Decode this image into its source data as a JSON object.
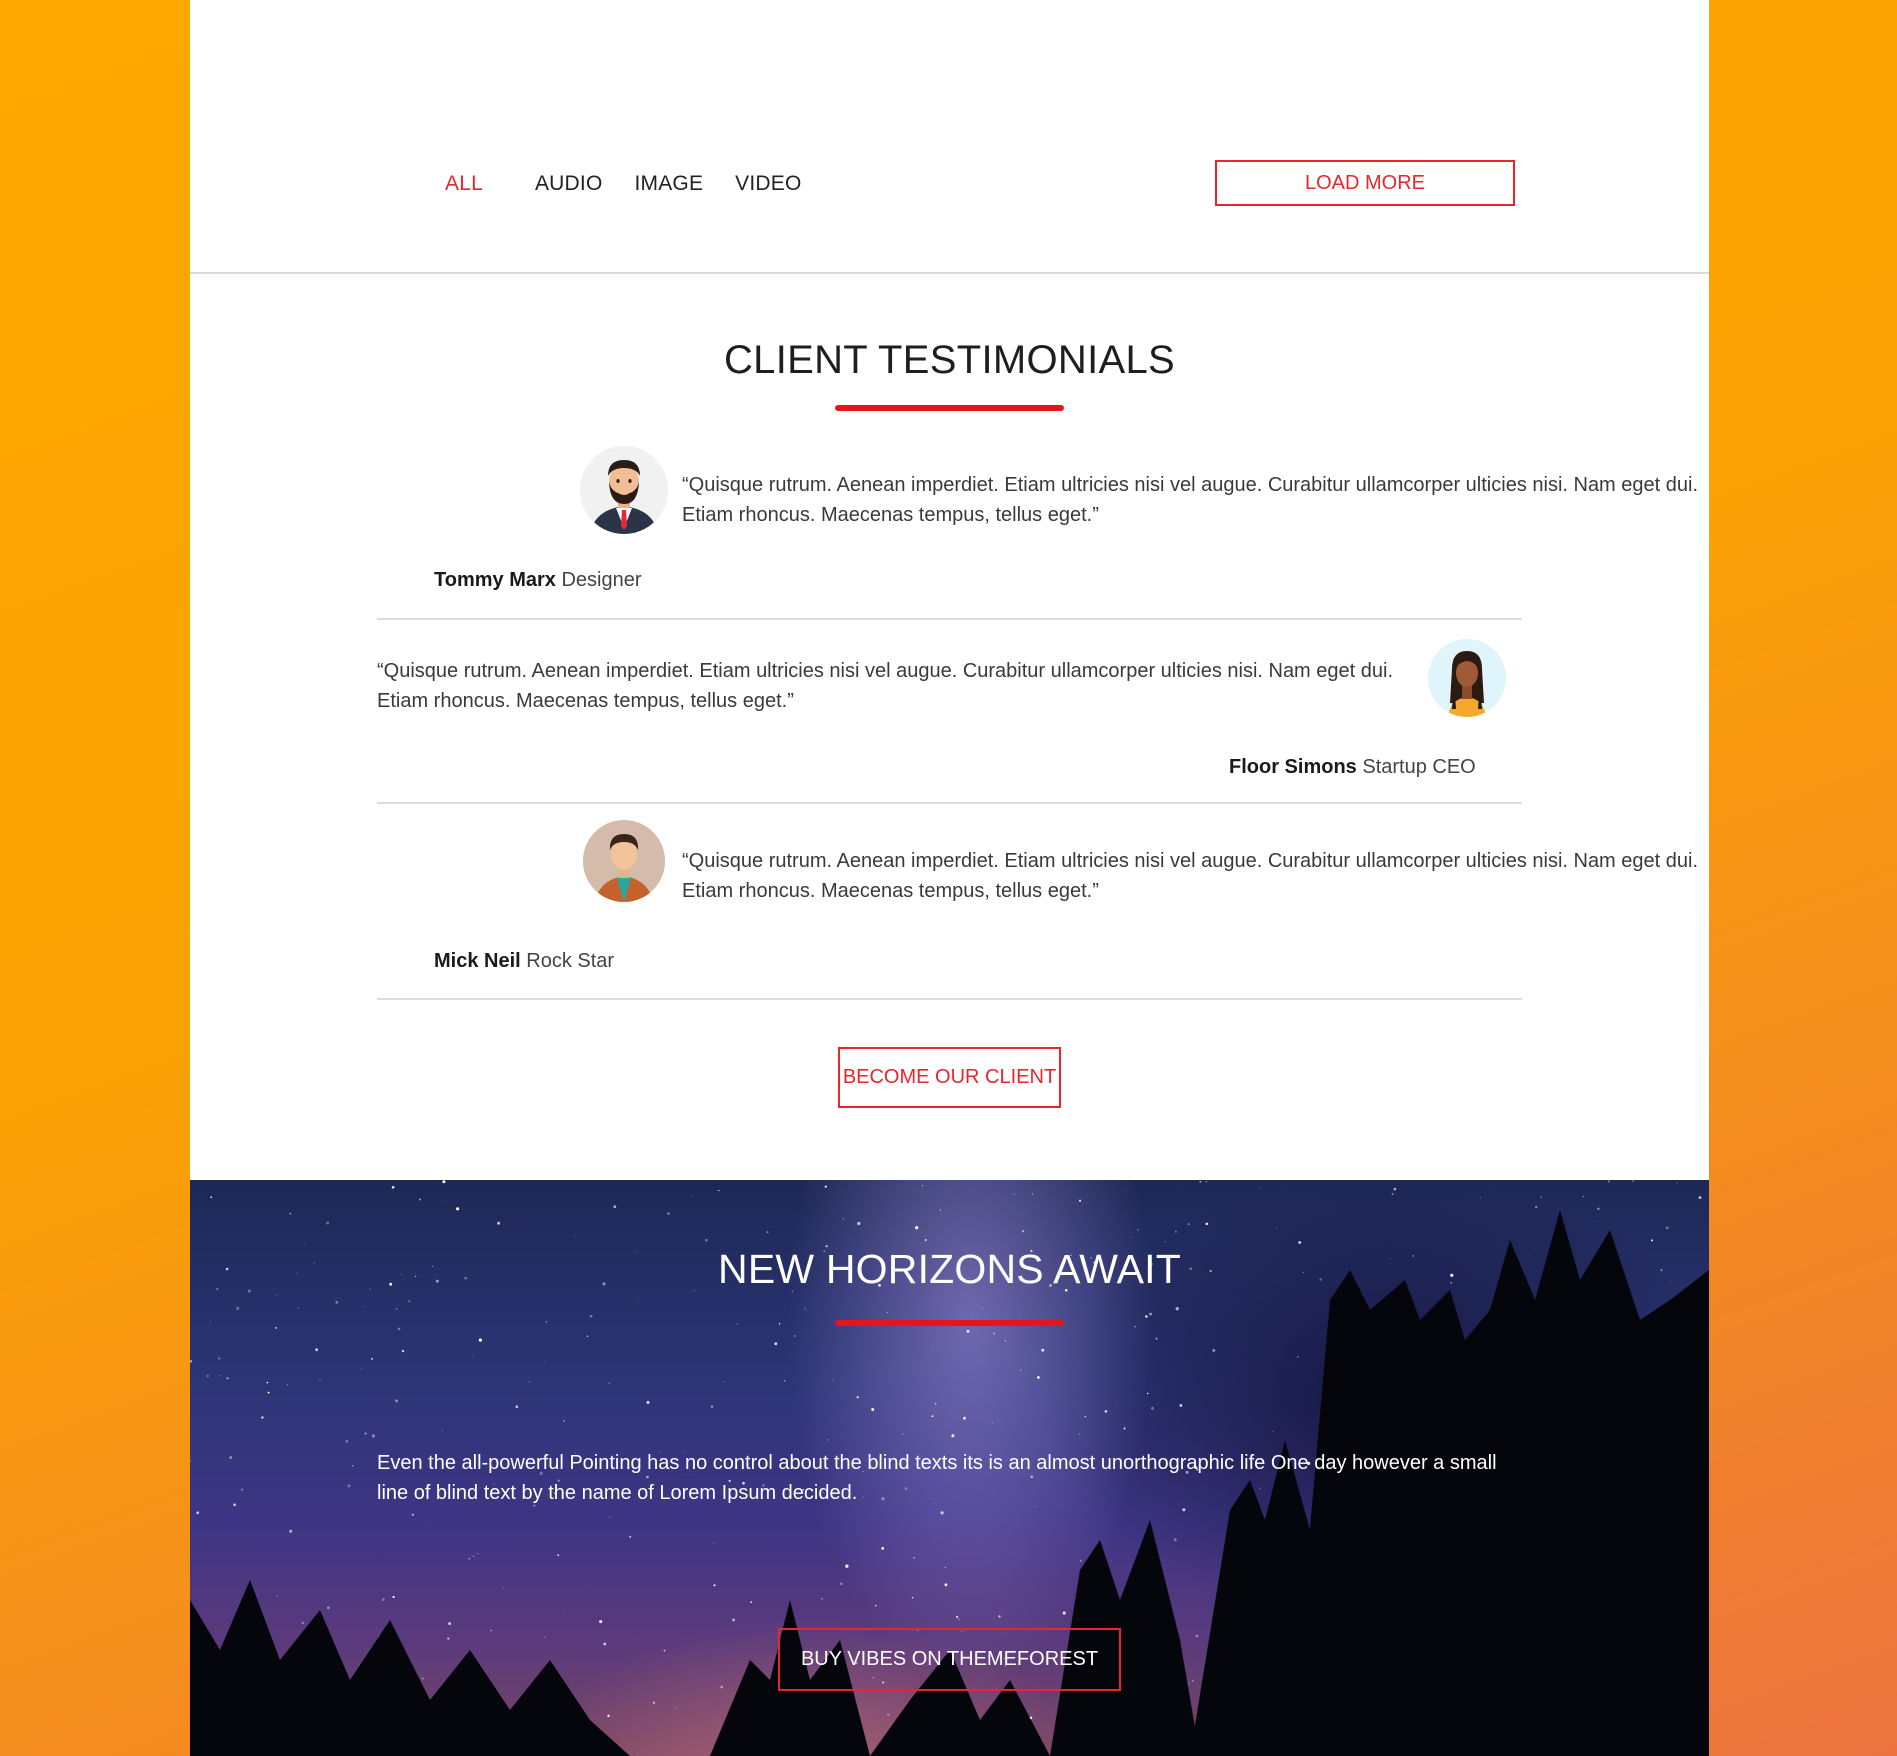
{
  "filters": {
    "items": [
      "ALL",
      "AUDIO",
      "IMAGE",
      "VIDEO"
    ],
    "active": "ALL",
    "load_more_label": "LOAD MORE"
  },
  "testimonials": {
    "title": "CLIENT TESTIMONIALS",
    "items": [
      {
        "quote": "“Quisque rutrum. Aenean imperdiet. Etiam ultricies nisi vel augue. Curabitur ullamcorper ulticies nisi. Nam eget dui. Etiam rhoncus. Maecenas tempus, tellus eget.”",
        "name": "Tommy Marx",
        "role": "Designer",
        "avatar_icon": "bearded-man-avatar-icon"
      },
      {
        "quote": "“Quisque rutrum. Aenean imperdiet. Etiam ultricies nisi vel augue. Curabitur ullamcorper ulticies nisi. Nam eget dui. Etiam rhoncus. Maecenas tempus, tellus eget.”",
        "name": "Floor Simons",
        "role": "Startup CEO",
        "avatar_icon": "woman-avatar-icon"
      },
      {
        "quote": "“Quisque rutrum. Aenean imperdiet. Etiam ultricies nisi vel augue. Curabitur ullamcorper ulticies nisi. Nam eget dui. Etiam rhoncus. Maecenas tempus, tellus eget.”",
        "name": "Mick Neil",
        "role": "Rock Star",
        "avatar_icon": "man-avatar-icon"
      }
    ],
    "cta_label": "BECOME OUR CLIENT"
  },
  "horizons": {
    "title": "NEW HORIZONS AWAIT",
    "text": "Even the all-powerful Pointing has no control about the blind texts its is an almost unorthographic life One day however a small line of blind text by the name of Lorem Ipsum decided.",
    "cta_label": "BUY VIBES ON THEMEFOREST"
  },
  "colors": {
    "accent": "#e8262c",
    "background_gradient_start": "#ffa800",
    "background_gradient_end": "#ec7340"
  }
}
